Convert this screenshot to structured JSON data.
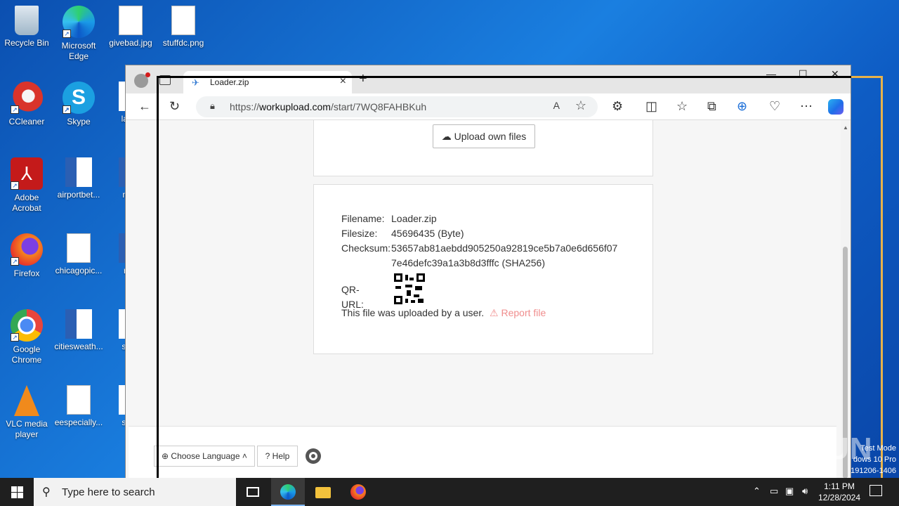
{
  "desktop": {
    "icons": [
      {
        "label": "Recycle Bin",
        "icon": "recycle-bin-icon"
      },
      {
        "label": "Microsoft Edge",
        "icon": "edge-icon"
      },
      {
        "label": "givebad.jpg",
        "icon": "image-file-icon"
      },
      {
        "label": "stuffdc.png",
        "icon": "image-file-icon"
      },
      {
        "label": "CCleaner",
        "icon": "ccleaner-icon"
      },
      {
        "label": "Skype",
        "icon": "skype-icon"
      },
      {
        "label": "large",
        "icon": "file-icon"
      },
      {
        "label": "Adobe Acrobat",
        "icon": "acrobat-icon"
      },
      {
        "label": "airportbet...",
        "icon": "word-doc-icon"
      },
      {
        "label": "mea",
        "icon": "word-doc-icon"
      },
      {
        "label": "Firefox",
        "icon": "firefox-icon"
      },
      {
        "label": "chicagopic...",
        "icon": "image-file-icon"
      },
      {
        "label": "real",
        "icon": "word-doc-icon"
      },
      {
        "label": "Google Chrome",
        "icon": "chrome-icon"
      },
      {
        "label": "citiesweath...",
        "icon": "word-doc-icon"
      },
      {
        "label": "situa",
        "icon": "file-icon"
      },
      {
        "label": "VLC media player",
        "icon": "vlc-icon"
      },
      {
        "label": "eespecially...",
        "icon": "image-file-icon"
      },
      {
        "label": "sonfl",
        "icon": "file-icon"
      }
    ]
  },
  "browser": {
    "tab_title": "Loader.zip",
    "tab_close": "×",
    "new_tab": "+",
    "url_prefix": "https://",
    "url_domain": "workupload.com",
    "url_path": "/start/7WQ8FAHBKuh"
  },
  "page": {
    "upload_button": "Upload own files",
    "file_info": {
      "filename_label": "Filename:",
      "filename": "Loader.zip",
      "filesize_label": "Filesize:",
      "filesize": "45696435 (Byte)",
      "checksum_label": "Checksum:",
      "checksum_line1": "53657ab81aebdd905250a92819ce5b7a0e6d656f07",
      "checksum_line2": "7e46defc39a1a3b8d3fffc (SHA256)",
      "qr_label": "QR-URL:"
    },
    "uploaded_text": "This file was uploaded by a user.",
    "report_link": "Report file",
    "choose_language": "Choose Language",
    "help": "? Help"
  },
  "overlay": {
    "watermark": "ANY RUN",
    "test_mode_line1": "Test Mode",
    "test_mode_line2": "dows 10 Pro",
    "test_mode_line3": "191206-1406"
  },
  "taskbar": {
    "search_placeholder": "Type here to search",
    "time": "1:11 PM",
    "date": "12/28/2024"
  },
  "colors": {
    "report_link": "#f08d8d",
    "accent_gold": "#e8b24a",
    "taskbar": "#1f1f1f"
  }
}
